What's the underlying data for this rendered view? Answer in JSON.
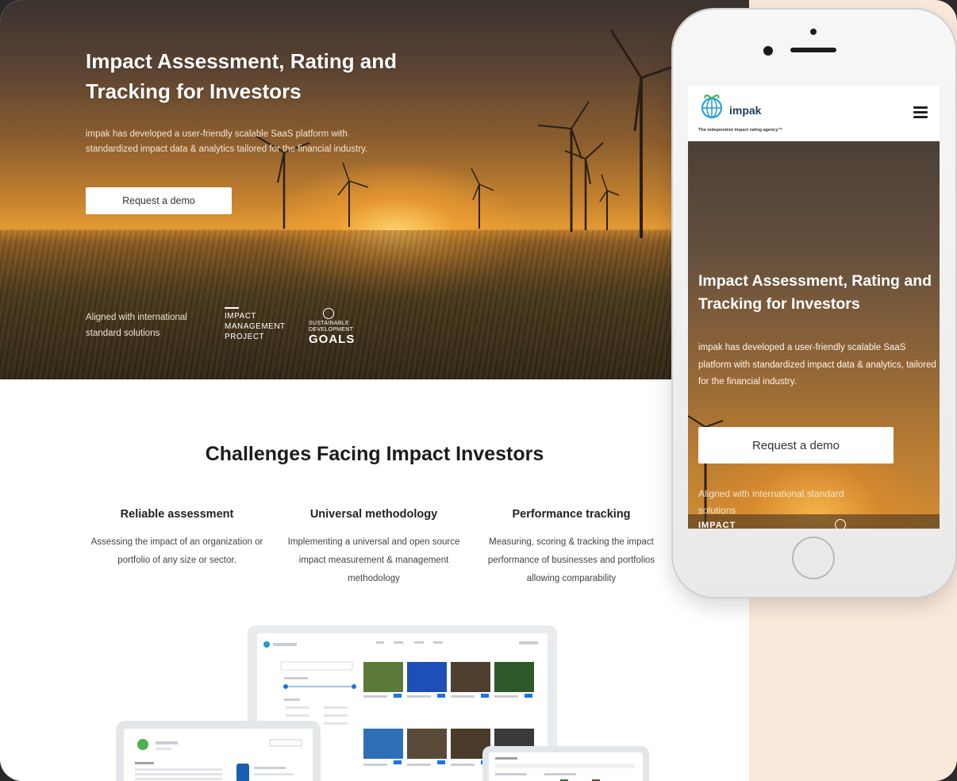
{
  "hero": {
    "title": "Impact Assessment, Rating and Tracking for Investors",
    "description": "impak has developed a user-friendly scalable SaaS platform with standardized impact data & analytics tailored for the financial industry.",
    "cta_label": "Request a demo",
    "aligned_text": "Aligned with international standard solutions",
    "imp_logo_text": "IMPACT MANAGEMENT PROJECT",
    "sdg_logo_small": "SUSTAINABLE DEVELOPMENT",
    "sdg_logo_big": "GOALS"
  },
  "challenges": {
    "title": "Challenges Facing Impact Investors",
    "columns": [
      {
        "heading": "Reliable assessment",
        "text": "Assessing the impact of an organization or portfolio of any size or sector."
      },
      {
        "heading": "Universal methodology",
        "text": "Implementing a universal and open source impact measurement & management methodology"
      },
      {
        "heading": "Performance tracking",
        "text": "Measuring, scoring & tracking the impact performance of businesses and portfolios allowing comparability"
      }
    ]
  },
  "phone": {
    "brand": "impak",
    "tagline": "The independent impact rating agency™",
    "title": "Impact Assessment, Rating and Tracking for Investors",
    "description": "impak has developed a user-friendly scalable SaaS platform with standardized impact data & analytics, tailored for the financial industry.",
    "cta_label": "Request a demo",
    "aligned_text": "Aligned with international standard solutions",
    "impact_text": "IMPACT"
  },
  "colors": {
    "page_bg": "#fbe9dc",
    "brand_blue": "#1f9ad6",
    "thumb_blue": "#1a73e8"
  }
}
